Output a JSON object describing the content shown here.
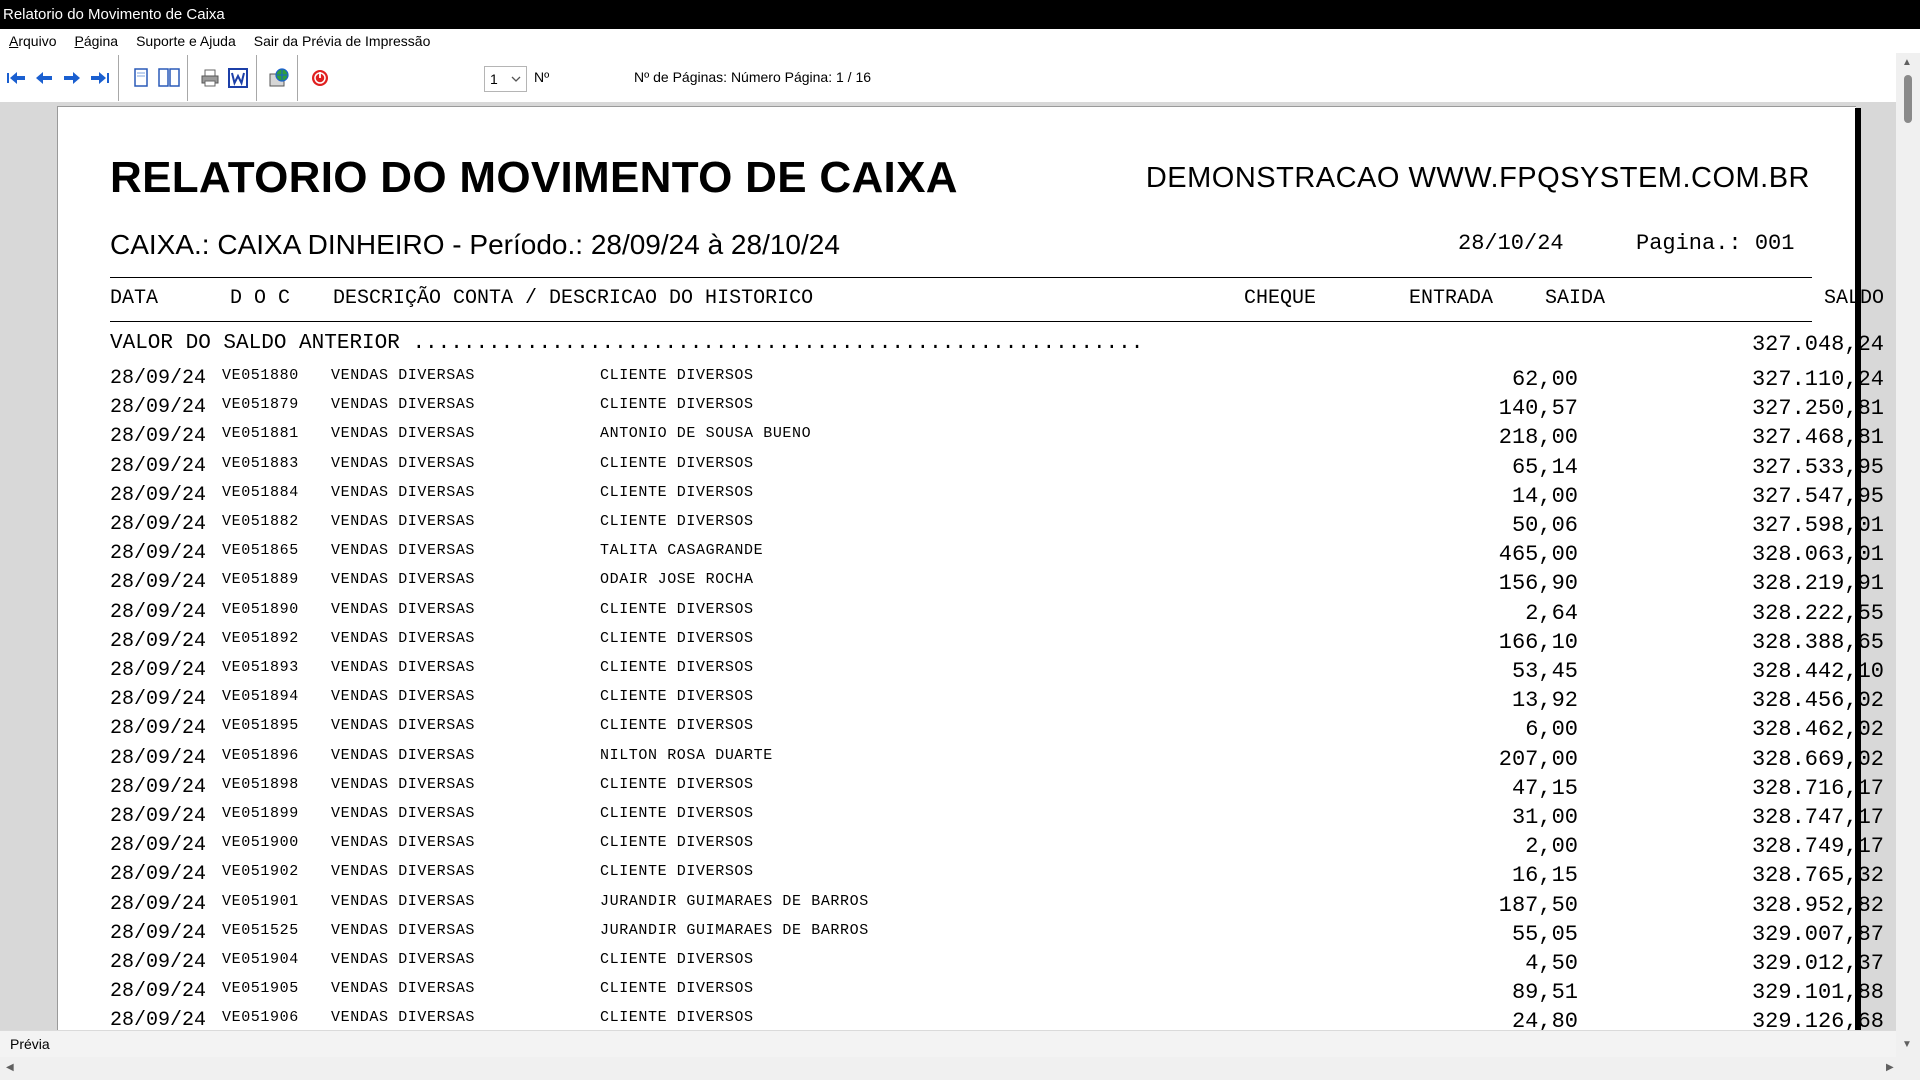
{
  "window": {
    "title": "Relatorio do Movimento de Caixa"
  },
  "menu": [
    {
      "label": "Arquivo",
      "hot": "A",
      "rest": "rquivo"
    },
    {
      "label": "Página",
      "hot": "P",
      "rest": "ágina"
    },
    {
      "label": "Suporte e Ajuda"
    },
    {
      "label": "Sair da Prévia de Impressão"
    }
  ],
  "toolbar": {
    "page_select_value": "1",
    "page_number_label": "Nº",
    "pages_info": "Nº de Páginas: Número Página: 1 / 16"
  },
  "report": {
    "title": "RELATORIO DO MOVIMENTO DE CAIXA",
    "site": "DEMONSTRACAO WWW.FPQSYSTEM.COM.BR",
    "caixa_line": "CAIXA.: CAIXA DINHEIRO -  Período.: 28/09/24 à 28/10/24",
    "date": "28/10/24",
    "page": "Pagina.: 001",
    "columns": {
      "data": "DATA",
      "doc": "D O C",
      "descricao": "DESCRIÇÃO CONTA / DESCRICAO DO HISTORICO",
      "cheque": "CHEQUE",
      "entrada": "ENTRADA",
      "saida": "SAIDA",
      "saldo": "SALDO"
    },
    "saldo_anterior_label": "VALOR DO SALDO ANTERIOR ..........................................................",
    "saldo_anterior_value": "327.048,24",
    "rows": [
      {
        "date": "28/09/24",
        "doc": "VE051880",
        "conta": "VENDAS DIVERSAS",
        "hist": "CLIENTE DIVERSOS",
        "entrada": "62,00",
        "saldo": "327.110,24"
      },
      {
        "date": "28/09/24",
        "doc": "VE051879",
        "conta": "VENDAS DIVERSAS",
        "hist": "CLIENTE DIVERSOS",
        "entrada": "140,57",
        "saldo": "327.250,81"
      },
      {
        "date": "28/09/24",
        "doc": "VE051881",
        "conta": "VENDAS DIVERSAS",
        "hist": "ANTONIO DE SOUSA BUENO",
        "entrada": "218,00",
        "saldo": "327.468,81"
      },
      {
        "date": "28/09/24",
        "doc": "VE051883",
        "conta": "VENDAS DIVERSAS",
        "hist": "CLIENTE DIVERSOS",
        "entrada": "65,14",
        "saldo": "327.533,95"
      },
      {
        "date": "28/09/24",
        "doc": "VE051884",
        "conta": "VENDAS DIVERSAS",
        "hist": "CLIENTE DIVERSOS",
        "entrada": "14,00",
        "saldo": "327.547,95"
      },
      {
        "date": "28/09/24",
        "doc": "VE051882",
        "conta": "VENDAS DIVERSAS",
        "hist": "CLIENTE DIVERSOS",
        "entrada": "50,06",
        "saldo": "327.598,01"
      },
      {
        "date": "28/09/24",
        "doc": "VE051865",
        "conta": "VENDAS DIVERSAS",
        "hist": "TALITA CASAGRANDE",
        "entrada": "465,00",
        "saldo": "328.063,01"
      },
      {
        "date": "28/09/24",
        "doc": "VE051889",
        "conta": "VENDAS DIVERSAS",
        "hist": "ODAIR JOSE ROCHA",
        "entrada": "156,90",
        "saldo": "328.219,91"
      },
      {
        "date": "28/09/24",
        "doc": "VE051890",
        "conta": "VENDAS DIVERSAS",
        "hist": "CLIENTE DIVERSOS",
        "entrada": "2,64",
        "saldo": "328.222,55"
      },
      {
        "date": "28/09/24",
        "doc": "VE051892",
        "conta": "VENDAS DIVERSAS",
        "hist": "CLIENTE DIVERSOS",
        "entrada": "166,10",
        "saldo": "328.388,65"
      },
      {
        "date": "28/09/24",
        "doc": "VE051893",
        "conta": "VENDAS DIVERSAS",
        "hist": "CLIENTE DIVERSOS",
        "entrada": "53,45",
        "saldo": "328.442,10"
      },
      {
        "date": "28/09/24",
        "doc": "VE051894",
        "conta": "VENDAS DIVERSAS",
        "hist": "CLIENTE DIVERSOS",
        "entrada": "13,92",
        "saldo": "328.456,02"
      },
      {
        "date": "28/09/24",
        "doc": "VE051895",
        "conta": "VENDAS DIVERSAS",
        "hist": "CLIENTE DIVERSOS",
        "entrada": "6,00",
        "saldo": "328.462,02"
      },
      {
        "date": "28/09/24",
        "doc": "VE051896",
        "conta": "VENDAS DIVERSAS",
        "hist": "NILTON ROSA DUARTE",
        "entrada": "207,00",
        "saldo": "328.669,02"
      },
      {
        "date": "28/09/24",
        "doc": "VE051898",
        "conta": "VENDAS DIVERSAS",
        "hist": "CLIENTE DIVERSOS",
        "entrada": "47,15",
        "saldo": "328.716,17"
      },
      {
        "date": "28/09/24",
        "doc": "VE051899",
        "conta": "VENDAS DIVERSAS",
        "hist": "CLIENTE DIVERSOS",
        "entrada": "31,00",
        "saldo": "328.747,17"
      },
      {
        "date": "28/09/24",
        "doc": "VE051900",
        "conta": "VENDAS DIVERSAS",
        "hist": "CLIENTE DIVERSOS",
        "entrada": "2,00",
        "saldo": "328.749,17"
      },
      {
        "date": "28/09/24",
        "doc": "VE051902",
        "conta": "VENDAS DIVERSAS",
        "hist": "CLIENTE DIVERSOS",
        "entrada": "16,15",
        "saldo": "328.765,32"
      },
      {
        "date": "28/09/24",
        "doc": "VE051901",
        "conta": "VENDAS DIVERSAS",
        "hist": "JURANDIR GUIMARAES DE BARROS",
        "entrada": "187,50",
        "saldo": "328.952,82"
      },
      {
        "date": "28/09/24",
        "doc": "VE051525",
        "conta": "VENDAS DIVERSAS",
        "hist": "JURANDIR GUIMARAES DE BARROS",
        "entrada": "55,05",
        "saldo": "329.007,87"
      },
      {
        "date": "28/09/24",
        "doc": "VE051904",
        "conta": "VENDAS DIVERSAS",
        "hist": "CLIENTE DIVERSOS",
        "entrada": "4,50",
        "saldo": "329.012,37"
      },
      {
        "date": "28/09/24",
        "doc": "VE051905",
        "conta": "VENDAS DIVERSAS",
        "hist": "CLIENTE DIVERSOS",
        "entrada": "89,51",
        "saldo": "329.101,88"
      },
      {
        "date": "28/09/24",
        "doc": "VE051906",
        "conta": "VENDAS DIVERSAS",
        "hist": "CLIENTE DIVERSOS",
        "entrada": "24,80",
        "saldo": "329.126,68"
      }
    ]
  },
  "status": {
    "text": "Prévia"
  },
  "icons": [
    "first-page-icon",
    "previous-page-icon",
    "next-page-icon",
    "last-page-icon",
    "single-page-icon",
    "two-pages-icon",
    "print-icon",
    "word-export-icon",
    "internet-icon",
    "close-preview-icon"
  ],
  "colors": {
    "titlebar": "#000000",
    "preview_bg": "#d8d8d8",
    "arrow_blue": "#1a5fd0",
    "close_red": "#e02020"
  }
}
